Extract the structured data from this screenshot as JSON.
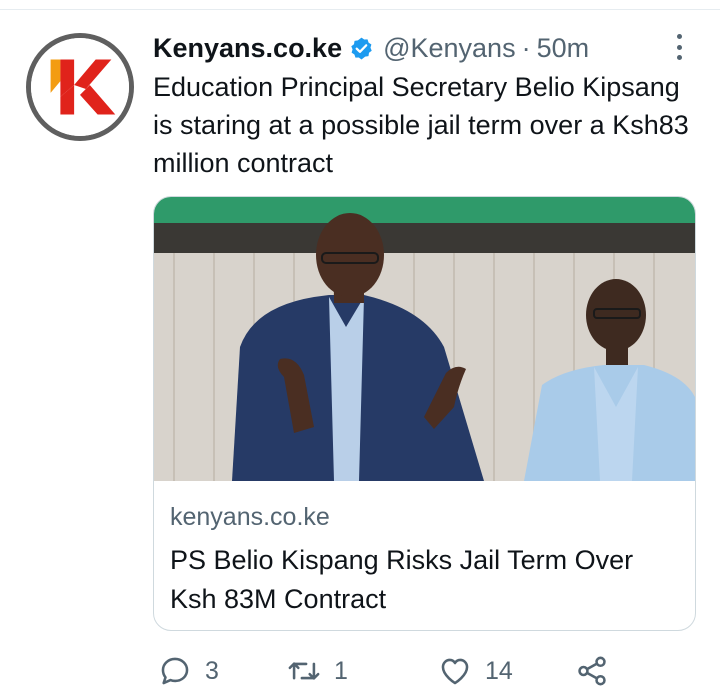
{
  "tweet": {
    "author": {
      "display_name": "Kenyans.co.ke",
      "handle": "@Kenyans",
      "verified": true,
      "avatar_icon": "kenyans-k-logo"
    },
    "separator": "·",
    "time": "50m",
    "text": "Education Principal Secretary Belio Kipsang is staring at a possible jail term over a Ksh83 million contract",
    "card": {
      "domain": "kenyans.co.ke",
      "title": "PS Belio Kispang Risks Jail Term Over Ksh 83M Contract"
    },
    "actions": {
      "reply": {
        "icon": "reply-icon",
        "count": "3"
      },
      "retweet": {
        "icon": "retweet-icon",
        "count": "1"
      },
      "like": {
        "icon": "heart-icon",
        "count": "14"
      },
      "share": {
        "icon": "share-icon"
      }
    }
  },
  "colors": {
    "text_primary": "#0f1419",
    "text_secondary": "#536471",
    "verified_blue": "#1d9bf0",
    "logo_red": "#e0231b",
    "logo_orange": "#f39c12",
    "card_border": "#cfd9de"
  }
}
